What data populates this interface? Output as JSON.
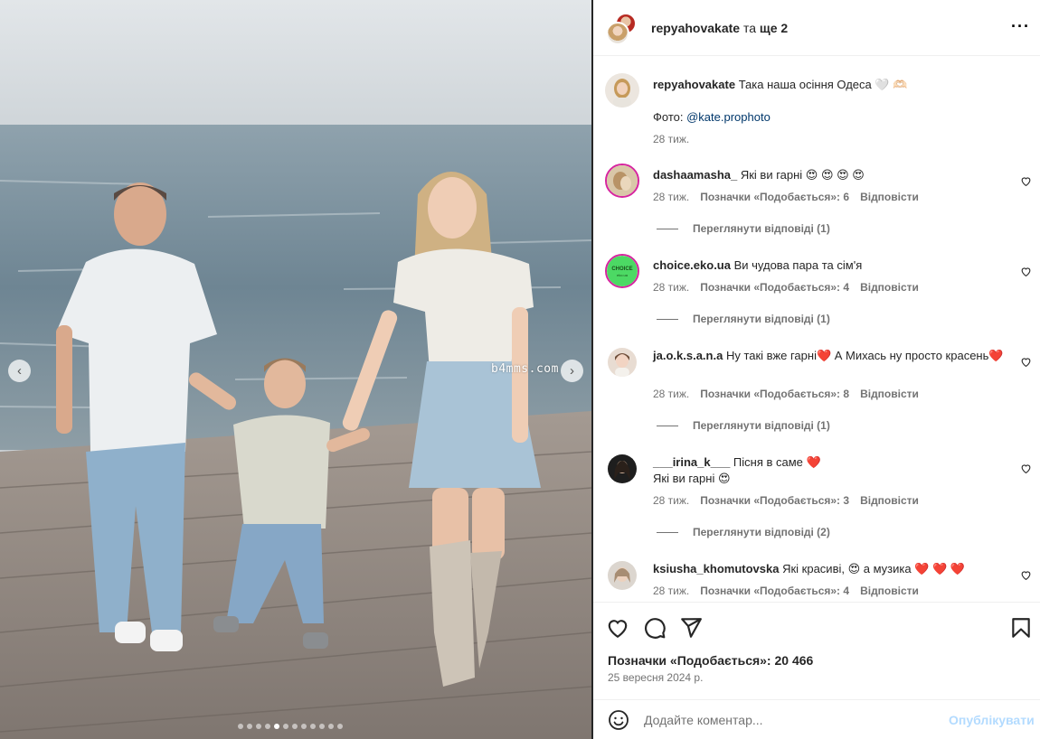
{
  "photo": {
    "watermark": "b4mms.com",
    "prev_icon": "chevron-left-icon",
    "next_icon": "chevron-right-icon",
    "dots_total": 12,
    "dots_active": 4
  },
  "header": {
    "username": "repyahovakate",
    "joiner": "та",
    "others": "ще 2",
    "more_icon": "more-horizontal-icon"
  },
  "caption": {
    "user": "repyahovakate",
    "text": "Така наша осіння Одеса 🤍 🫶🏻",
    "photo_label": "Фото:",
    "photo_mention": "@kate.prophoto",
    "time": "28 тиж."
  },
  "comments": [
    {
      "user": "dashaamasha_",
      "text": "Які ви гарні 😍 😍 😍 😍",
      "time": "28 тиж.",
      "likes": "Позначки «Подобається»: 6",
      "reply": "Відповісти",
      "view_replies": "Переглянути відповіді (1)"
    },
    {
      "user": "choice.eko.ua",
      "text": "Ви чудова пара та сім'я",
      "time": "28 тиж.",
      "likes": "Позначки «Подобається»: 4",
      "reply": "Відповісти",
      "view_replies": "Переглянути відповіді (1)"
    },
    {
      "user": "ja.o.k.s.a.n.a",
      "text": "Ну такі вже гарні❤️ А Михась ну просто красень❤️",
      "time": "28 тиж.",
      "likes": "Позначки «Подобається»: 8",
      "reply": "Відповісти",
      "view_replies": "Переглянути відповіді (1)"
    },
    {
      "user": "___irina_k___",
      "text": "Пісня в саме ❤️",
      "text2": "Які ви гарні 😍",
      "time": "28 тиж.",
      "likes": "Позначки «Подобається»: 3",
      "reply": "Відповісти",
      "view_replies": "Переглянути відповіді (2)"
    },
    {
      "user": "ksiusha_khomutovska",
      "text": "Які красиві, 😍 а музика ❤️ ❤️ ❤️",
      "time": "28 тиж.",
      "likes": "Позначки «Подобається»: 4",
      "reply": "Відповісти"
    }
  ],
  "actions": {
    "like_icon": "heart-icon",
    "comment_icon": "comment-icon",
    "share_icon": "send-icon",
    "save_icon": "bookmark-icon",
    "likes": "Позначки «Подобається»: 20 466",
    "date": "25 вересня 2024 р."
  },
  "add_comment": {
    "emoji_icon": "smiley-icon",
    "placeholder": "Додайте коментар...",
    "post_label": "Опублікувати"
  },
  "colors": {
    "link": "#00376b",
    "muted": "#737373",
    "post_disabled": "#b3dbff",
    "choice_avatar": "#4cd964"
  }
}
